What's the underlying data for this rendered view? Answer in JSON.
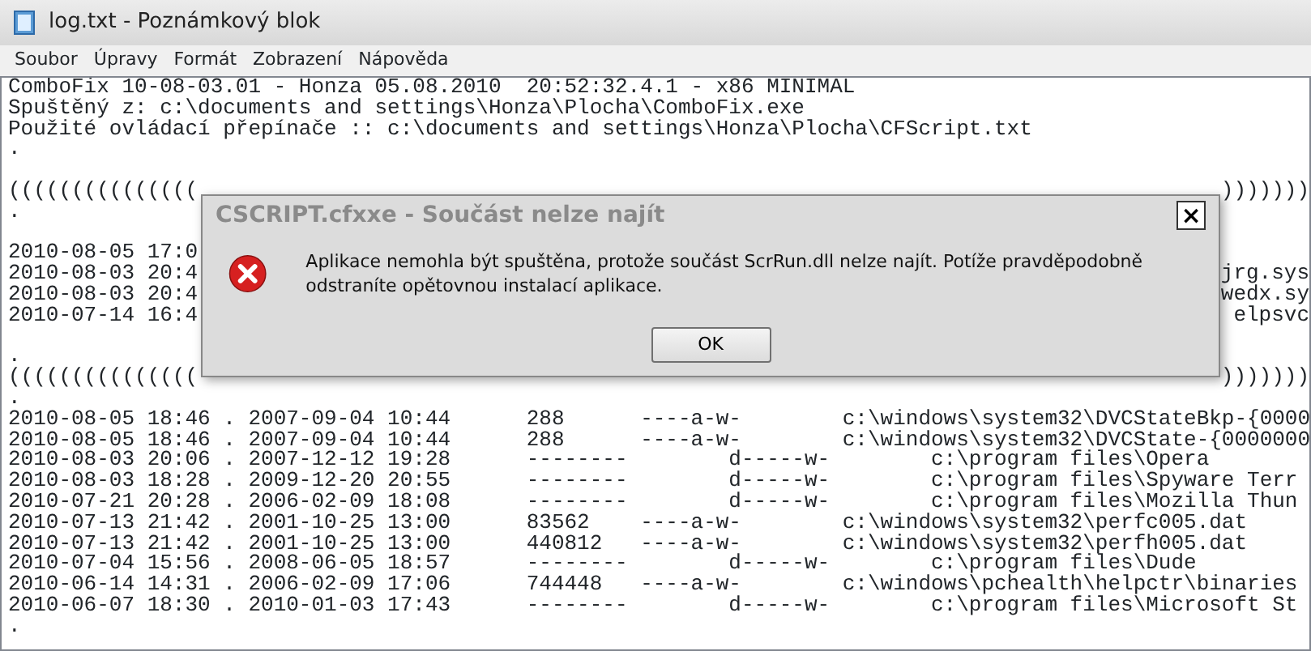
{
  "window": {
    "title": "log.txt - Poznámkový blok"
  },
  "menu": [
    "Soubor",
    "Úpravy",
    "Formát",
    "Zobrazení",
    "Nápověda"
  ],
  "lines": [
    {
      "kind": "text",
      "text": "ComboFix 10-08-03.01 - Honza 05.08.2010  20:52:32.4.1 - x86 MINIMAL"
    },
    {
      "kind": "text",
      "text": "Spuštěný z: c:\\documents and settings\\Honza\\Plocha\\ComboFix.exe"
    },
    {
      "kind": "text",
      "text": "Použité ovládací přepínače :: c:\\documents and settings\\Honza\\Plocha\\CFScript.txt"
    },
    {
      "kind": "text",
      "text": "."
    },
    {
      "kind": "blank"
    },
    {
      "kind": "text",
      "text": "(((((((((((((((",
      "tail": ")))))))"
    },
    {
      "kind": "text",
      "text": "."
    },
    {
      "kind": "blank"
    },
    {
      "kind": "text",
      "text": "2010-08-05 17:0"
    },
    {
      "kind": "text",
      "text": "2010-08-03 20:4",
      "tail": "jrg.sys"
    },
    {
      "kind": "text",
      "text": "2010-08-03 20:4",
      "tail": "wedx.sy"
    },
    {
      "kind": "text",
      "text": "2010-07-14 16:4",
      "tail": "elpsvc"
    },
    {
      "kind": "blank"
    },
    {
      "kind": "text",
      "text": "."
    },
    {
      "kind": "text",
      "text": "(((((((((((((((",
      "tail": ")))))))"
    },
    {
      "kind": "text",
      "text": "."
    },
    {
      "kind": "text",
      "text": "2010-08-05 18:46 . 2007-09-04 10:44      288      ----a-w-        c:\\windows\\system32\\DVCStateBkp-{0000"
    },
    {
      "kind": "text",
      "text": "2010-08-05 18:46 . 2007-09-04 10:44      288      ----a-w-        c:\\windows\\system32\\DVCState-{0000000"
    },
    {
      "kind": "text",
      "text": "2010-08-03 20:06 . 2007-12-12 19:28      --------        d-----w-        c:\\program files\\Opera"
    },
    {
      "kind": "text",
      "text": "2010-08-03 18:28 . 2009-12-20 20:55      --------        d-----w-        c:\\program files\\Spyware Terr"
    },
    {
      "kind": "text",
      "text": "2010-07-21 20:28 . 2006-02-09 18:08      --------        d-----w-        c:\\program files\\Mozilla Thun"
    },
    {
      "kind": "text",
      "text": "2010-07-13 21:42 . 2001-10-25 13:00      83562    ----a-w-        c:\\windows\\system32\\perfc005.dat"
    },
    {
      "kind": "text",
      "text": "2010-07-13 21:42 . 2001-10-25 13:00      440812   ----a-w-        c:\\windows\\system32\\perfh005.dat"
    },
    {
      "kind": "text",
      "text": "2010-07-04 15:56 . 2008-06-05 18:57      --------        d-----w-        c:\\program files\\Dude"
    },
    {
      "kind": "text",
      "text": "2010-06-14 14:31 . 2006-02-09 17:06      744448   ----a-w-        c:\\windows\\pchealth\\helpctr\\binaries"
    },
    {
      "kind": "text",
      "text": "2010-06-07 18:30 . 2010-01-03 17:43      --------        d-----w-        c:\\program files\\Microsoft St"
    },
    {
      "kind": "text",
      "text": "."
    }
  ],
  "dialog": {
    "title": "CSCRIPT.cfxxe - Součást nelze najít",
    "close": "×",
    "message": "Aplikace nemohla být spuštěna, protože součást ScrRun.dll nelze najít. Potíže pravděpodobně odstraníte opětovnou instalací aplikace.",
    "buttons": [
      "OK"
    ]
  }
}
